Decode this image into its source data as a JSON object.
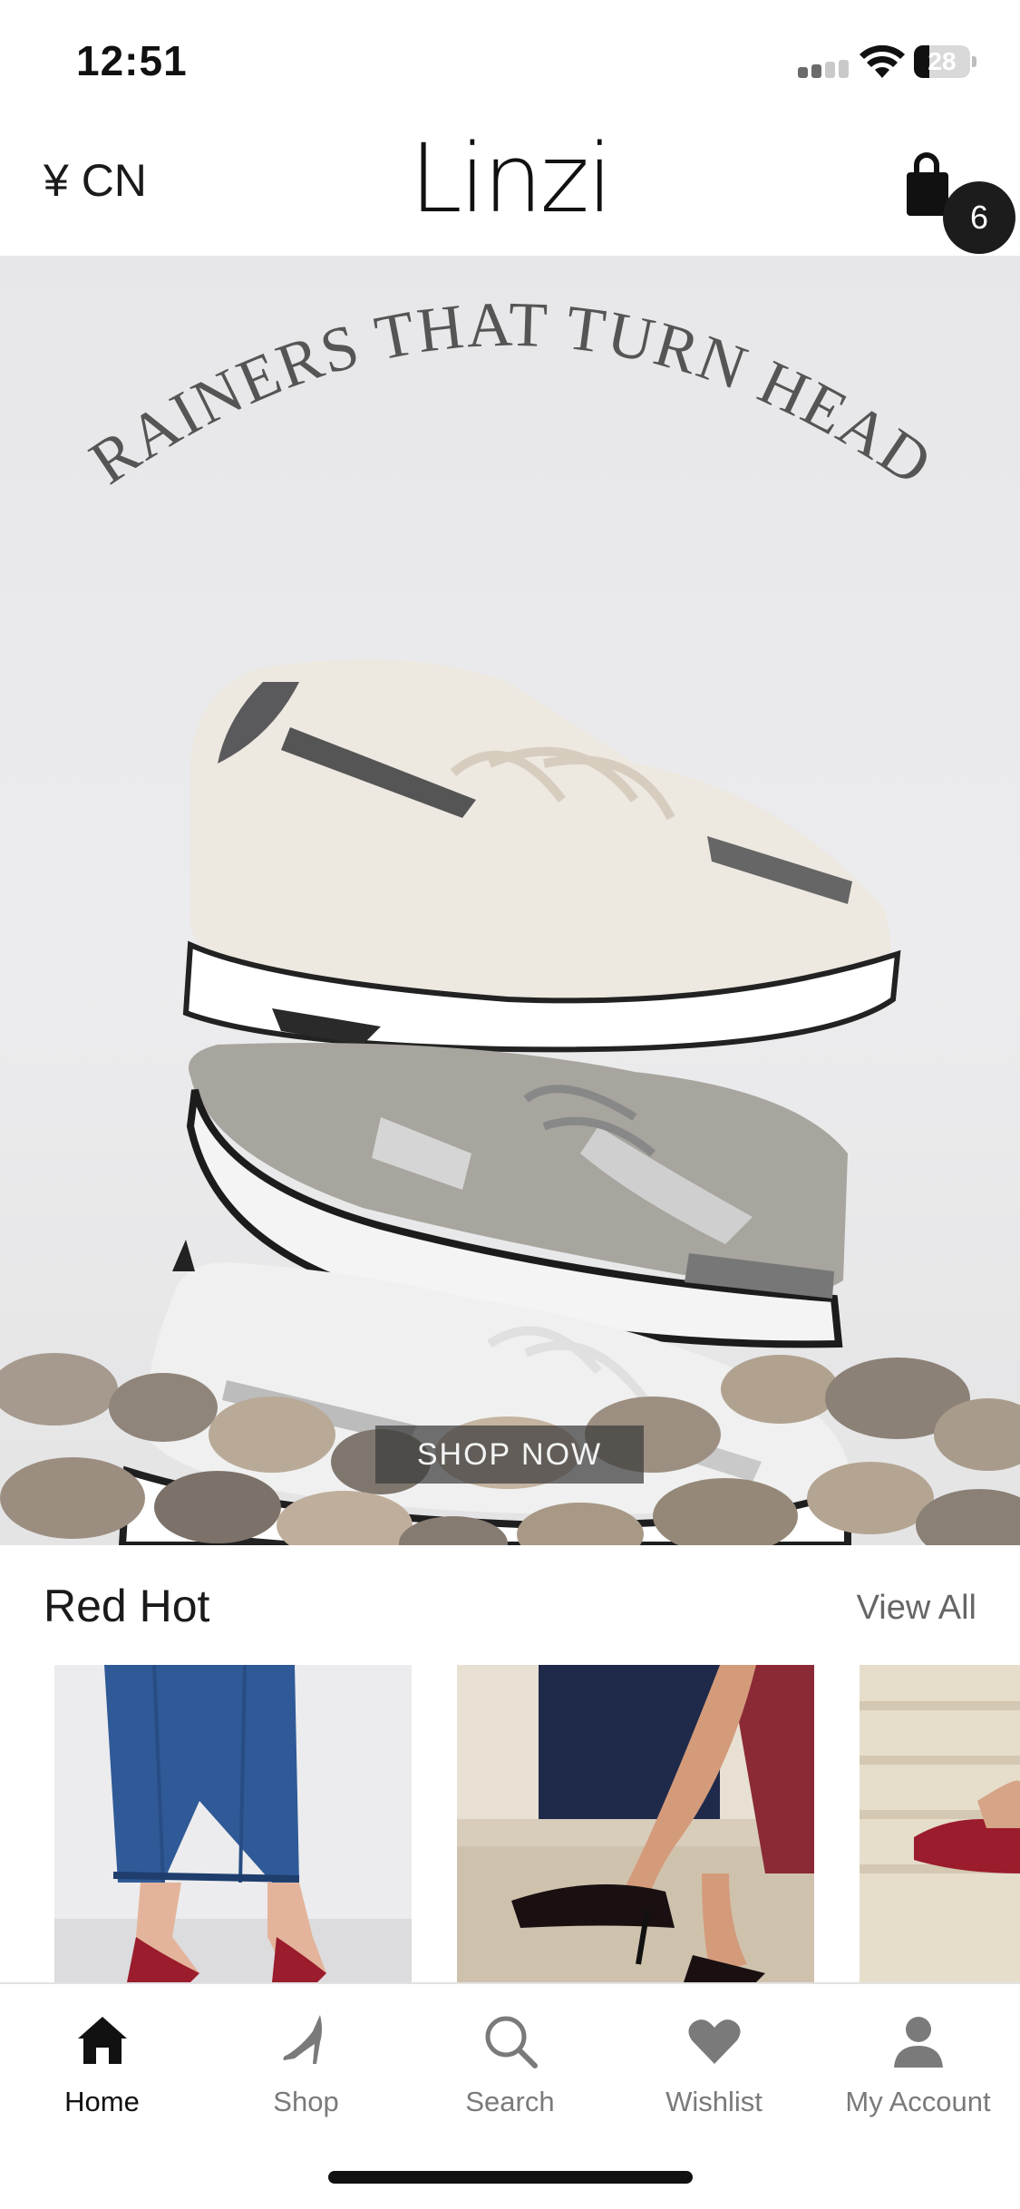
{
  "status_bar": {
    "time": "12:51",
    "battery": "28",
    "battery_level": 0.28
  },
  "header": {
    "currency": "¥ CN",
    "logo": "Linzi",
    "cart_count": "6"
  },
  "hero": {
    "headline": "TRAINERS THAT TURN HEADS",
    "cta": "SHOP NOW"
  },
  "section": {
    "title": "Red Hot",
    "view_all": "View All"
  },
  "tabs": [
    {
      "label": "Home",
      "icon": "home-icon",
      "active": true
    },
    {
      "label": "Shop",
      "icon": "heel-shoe-icon",
      "active": false
    },
    {
      "label": "Search",
      "icon": "search-icon",
      "active": false
    },
    {
      "label": "Wishlist",
      "icon": "heart-icon",
      "active": false
    },
    {
      "label": "My Account",
      "icon": "account-icon",
      "active": false
    }
  ],
  "colors": {
    "accent": "#111111",
    "inactive": "#7a7a7a",
    "shoe_red": "#9b1c2c"
  }
}
